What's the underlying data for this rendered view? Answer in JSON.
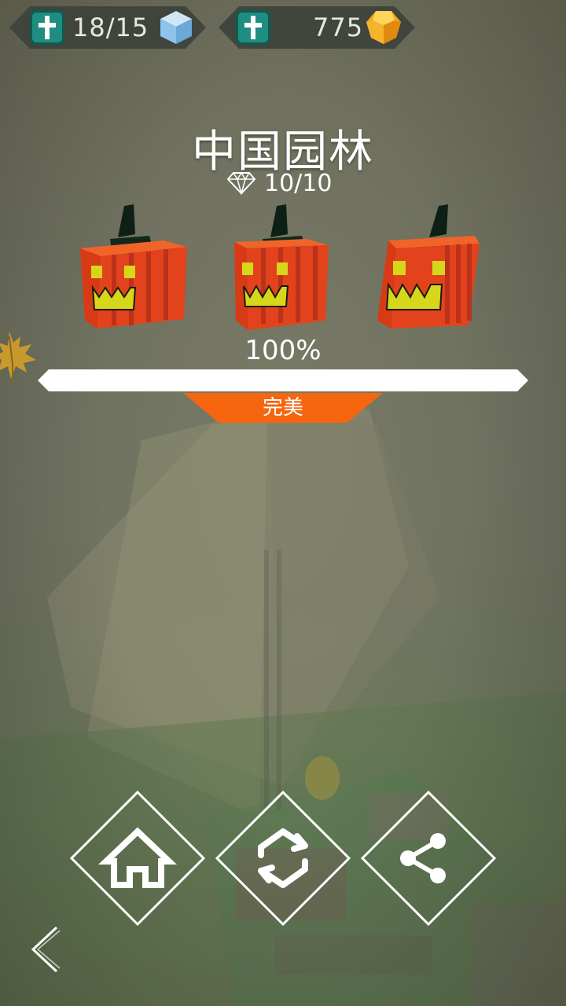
{
  "hud": {
    "left": {
      "value": "18/15",
      "badge_icon": "teal-cross-icon",
      "resource_icon": "blue-cube-icon"
    },
    "right": {
      "value": "775",
      "badge_icon": "teal-cross-icon",
      "resource_icon": "gold-gem-icon"
    }
  },
  "level": {
    "title": "中国园林",
    "gems": "10/10",
    "gem_icon": "diamond-outline-icon",
    "pumpkins_earned": 3,
    "percent_label": "100%",
    "progress": 1.0,
    "rating": "完美"
  },
  "buttons": {
    "home_icon": "home-icon",
    "replay_icon": "replay-icon",
    "share_icon": "share-icon",
    "back_icon": "chevron-left-icon"
  },
  "colors": {
    "rating_tab": "#f5660f",
    "badge_teal": "#1f8e80",
    "pumpkin_orange": "#e2431c",
    "pumpkin_face": "#d6d61b"
  }
}
